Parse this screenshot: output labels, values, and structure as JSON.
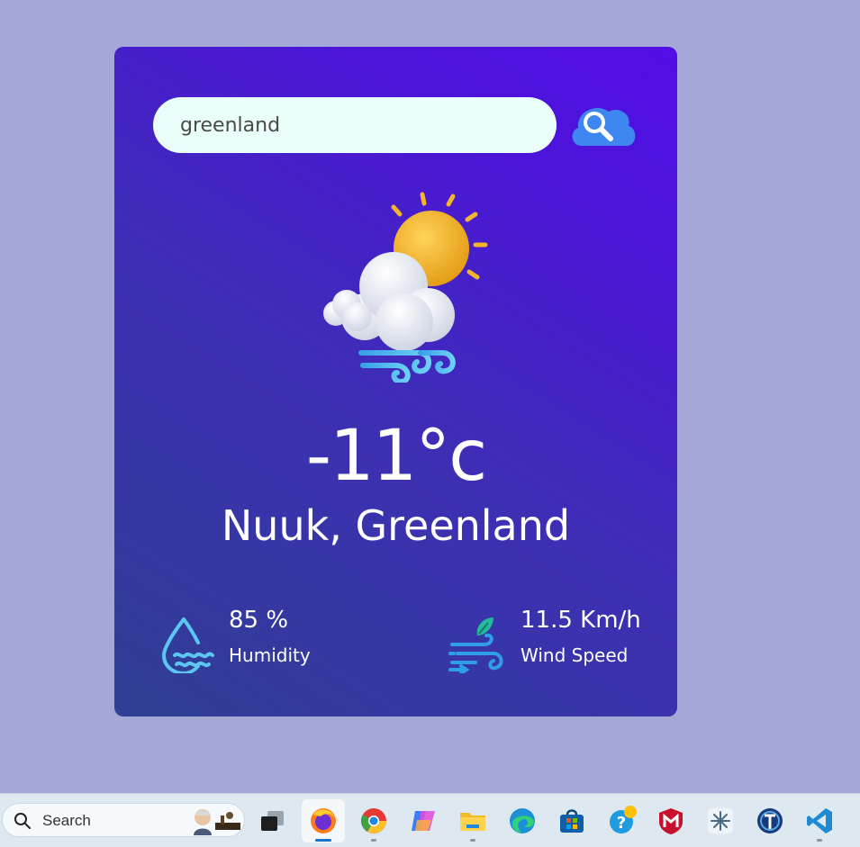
{
  "search": {
    "value": "greenland",
    "placeholder": ""
  },
  "weather": {
    "temperature": "-11°c",
    "city": "Nuuk, Greenland",
    "condition_icon": "partly-cloudy-windy-icon"
  },
  "details": {
    "humidity": {
      "value": "85 %",
      "label": "Humidity",
      "icon": "humidity-icon"
    },
    "wind": {
      "value": "11.5 Km/h",
      "label": "Wind Speed",
      "icon": "wind-icon"
    }
  },
  "taskbar": {
    "search_label": "Search",
    "apps": [
      "task-view",
      "firefox",
      "chrome",
      "copilot",
      "file-explorer",
      "edge",
      "microsoft-store",
      "help",
      "mcafee",
      "snipping-tool",
      "app",
      "vscode"
    ]
  },
  "colors": {
    "background": "#a3a8d7",
    "card_gradient_start": "#2f3f92",
    "card_gradient_end": "#520ee6",
    "input_bg": "#eafff9"
  }
}
